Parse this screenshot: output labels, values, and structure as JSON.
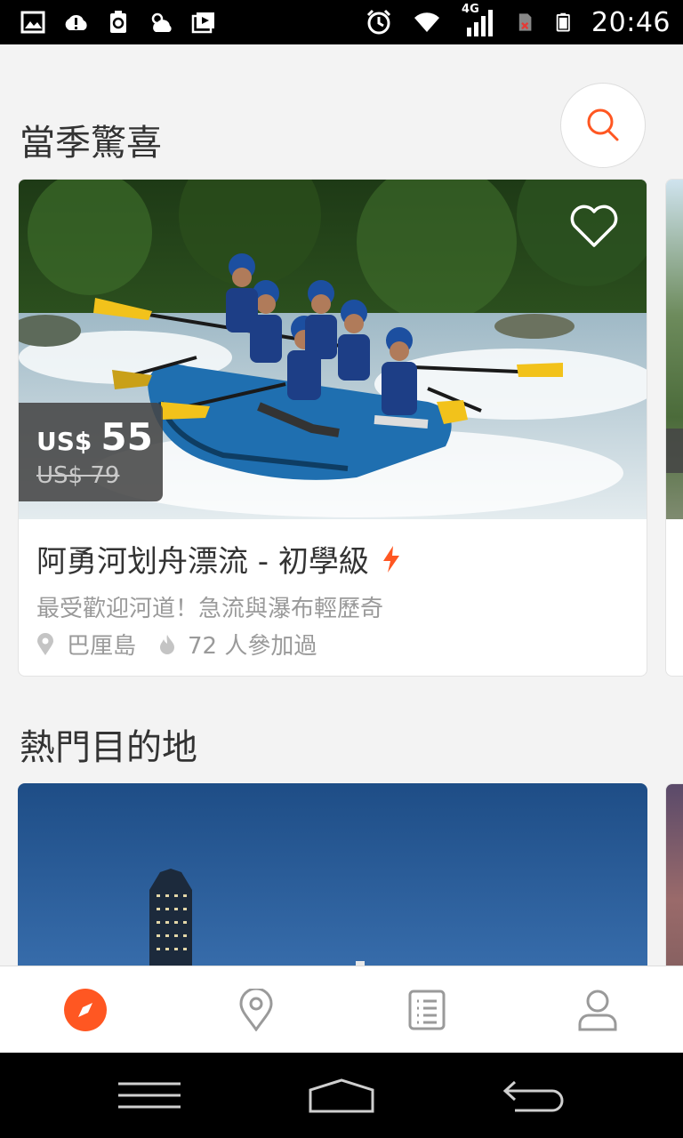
{
  "status_bar": {
    "time": "20:46",
    "network": "4G",
    "left_icons": [
      "image-icon",
      "cloud-alert-icon",
      "recycle-icon",
      "weather-icon",
      "media-icon"
    ],
    "right_icons": [
      "alarm-icon",
      "wifi-icon",
      "signal-icon",
      "no-sim-icon",
      "battery-icon"
    ]
  },
  "sections": {
    "seasonal_title": "當季驚喜",
    "destinations_title": "熱門目的地"
  },
  "activity_card": {
    "title": "阿勇河划舟漂流 - 初學級",
    "subtitle": "最受歡迎河道！急流與瀑布輕歷奇",
    "location": "巴厘島",
    "participants": "72 人參加過",
    "price_currency": "US$",
    "price_amount": "55",
    "original_price": "US$ 79"
  },
  "bottom_nav": {
    "items": [
      {
        "name": "explore",
        "icon": "compass-icon",
        "active": true
      },
      {
        "name": "destinations",
        "icon": "map-pin-icon",
        "active": false
      },
      {
        "name": "bookings",
        "icon": "list-icon",
        "active": false
      },
      {
        "name": "account",
        "icon": "user-icon",
        "active": false
      }
    ]
  },
  "colors": {
    "accent": "#ff5722",
    "text_primary": "#333333",
    "text_secondary": "#9a9a9a",
    "background": "#f3f3f3"
  }
}
